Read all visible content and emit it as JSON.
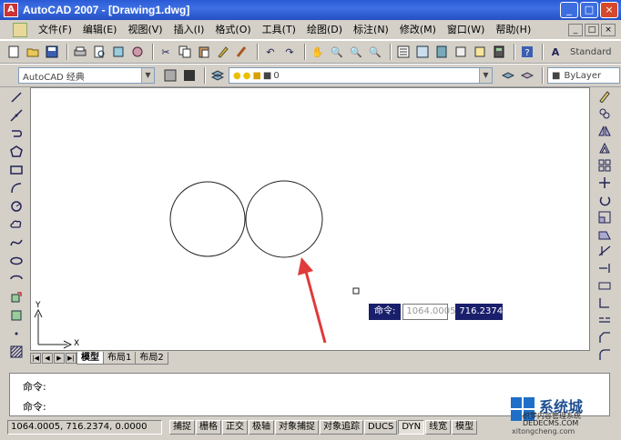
{
  "window": {
    "title": "AutoCAD 2007 - [Drawing1.dwg]",
    "app_icon": "A",
    "buttons": [
      "_",
      "□",
      "×"
    ]
  },
  "menubar": {
    "items": [
      "文件(F)",
      "编辑(E)",
      "视图(V)",
      "插入(I)",
      "格式(O)",
      "工具(T)",
      "绘图(D)",
      "标注(N)",
      "修改(M)",
      "窗口(W)",
      "帮助(H)"
    ],
    "right_controls": [
      "_",
      "□",
      "×"
    ]
  },
  "toolbar": {
    "style_label": "Standard"
  },
  "toolbar2": {
    "workspace": "AutoCAD 经典",
    "layer": "0",
    "linetype": "ByLayer"
  },
  "canvas": {
    "ucs_x": "X",
    "ucs_y": "Y"
  },
  "dynamic_input": {
    "label": "命令:",
    "x_value": "1064.0005",
    "y_value": "716.2374"
  },
  "tabs": {
    "items": [
      "模型",
      "布局1",
      "布局2"
    ],
    "active": "模型"
  },
  "command": {
    "line1": "命令:",
    "line2": "命令:"
  },
  "status": {
    "coords": "1064.0005, 716.2374, 0.0000",
    "buttons": [
      "捕捉",
      "栅格",
      "正交",
      "极轴",
      "对象捕捉",
      "对象追踪",
      "DUCS",
      "DYN",
      "线宽",
      "模型"
    ]
  },
  "watermark": {
    "text1": "系统城",
    "text2": "织梦内容管理系统",
    "text3": "DEDECMS.COM",
    "text4": "xitongcheng.com"
  },
  "colors": {
    "titlebar": "#2a5bd6",
    "dyn_box": "#1a1f6b",
    "arrow": "#e03a3a"
  }
}
